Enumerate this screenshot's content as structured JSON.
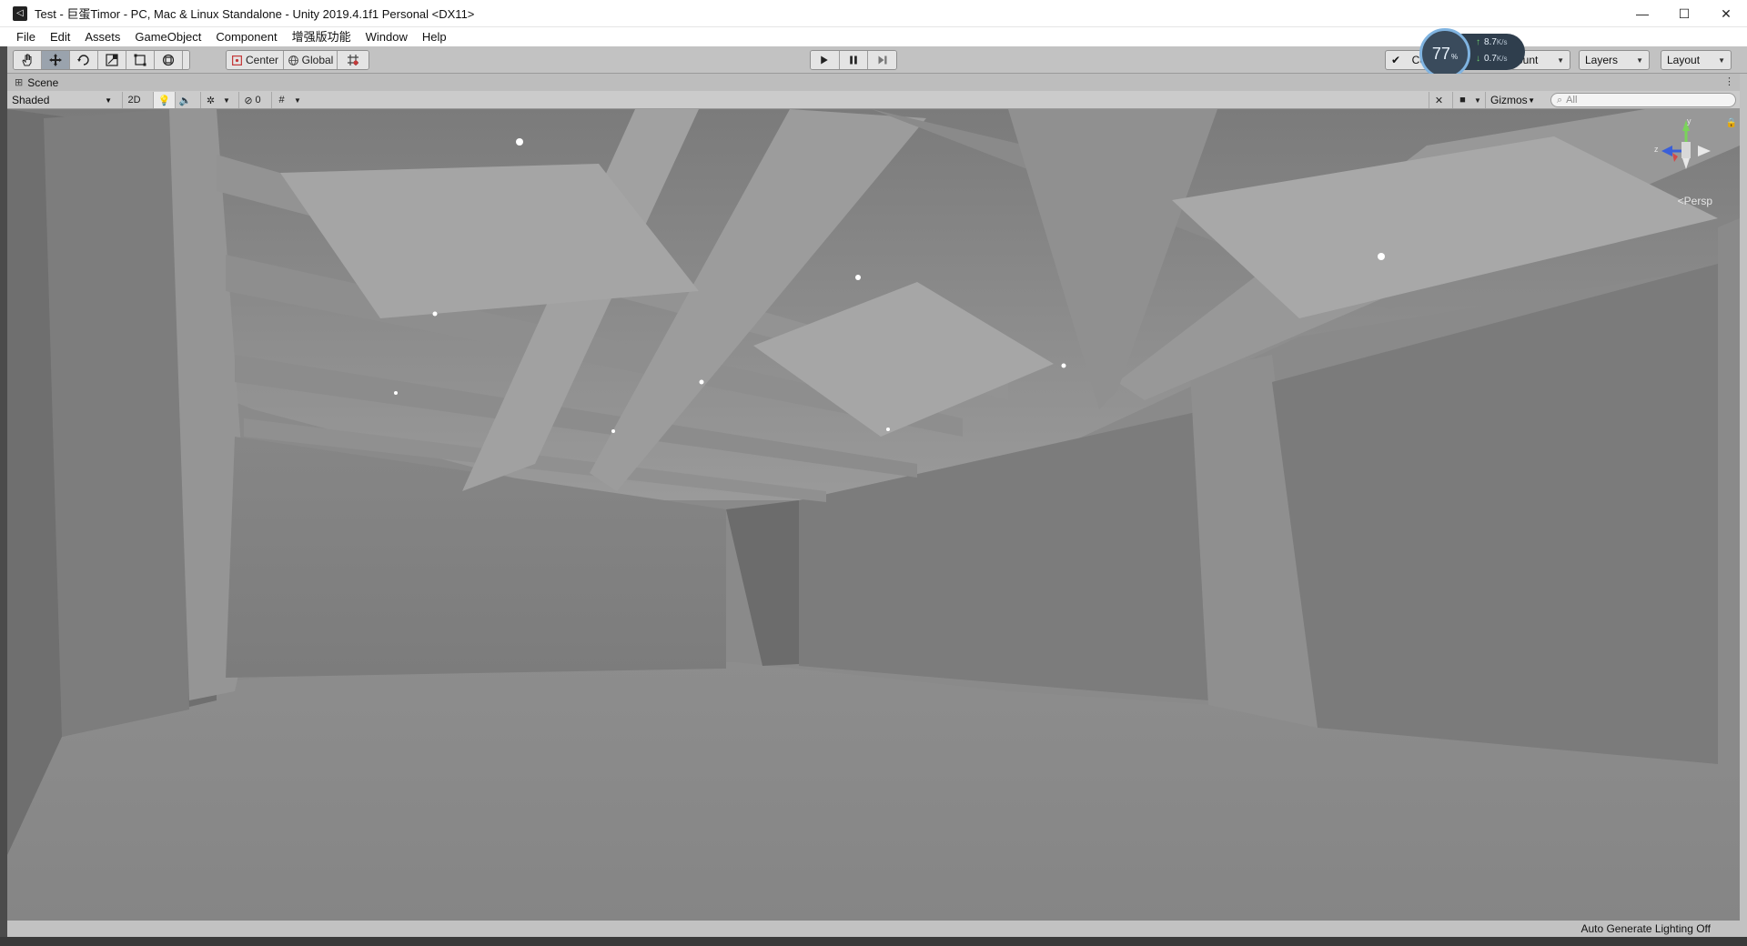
{
  "window": {
    "title": "Test - 巨蛋Timor - PC, Mac & Linux Standalone - Unity 2019.4.1f1 Personal <DX11>",
    "min_glyph": "—",
    "max_glyph": "☐",
    "close_glyph": "✕"
  },
  "menu": {
    "items": [
      "File",
      "Edit",
      "Assets",
      "GameObject",
      "Component",
      "增强版功能",
      "Window",
      "Help"
    ]
  },
  "toolbar": {
    "pivot_label": "Center",
    "space_label": "Global",
    "collab_label": "Co",
    "account_label": "ount",
    "layers_label": "Layers",
    "layout_label": "Layout"
  },
  "netmon": {
    "percent": "77",
    "percent_unit": "%",
    "upload": "8.7",
    "download": "0.7",
    "rate_unit": "K/s"
  },
  "scene": {
    "tab_label": "Scene",
    "shading_mode": "Shaded",
    "toggle_2d": "2D",
    "hidden_count": "0",
    "gizmos_label": "Gizmos",
    "search_placeholder": "All",
    "persp_label": "Persp",
    "axis_y": "y",
    "axis_z": "z"
  },
  "status": {
    "text": "Auto Generate Lighting Off"
  },
  "colors": {
    "accent": "#9aa3ad",
    "toolbar_bg": "#c2c2c2",
    "viewport_bg": "#8a8a8a"
  }
}
